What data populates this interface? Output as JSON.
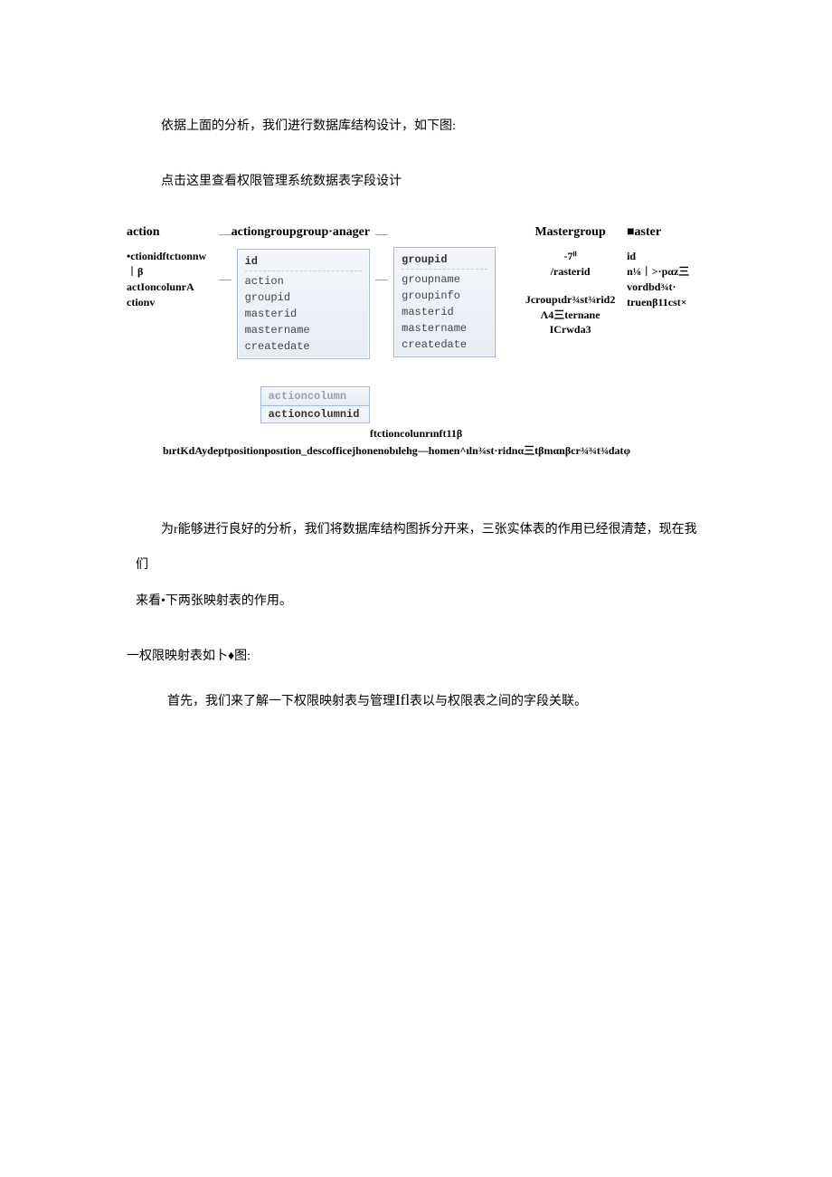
{
  "p1": "依据上面的分析，我们进行数据库结构设计，如下图:",
  "p2": "点击这里查看权限管理系统数据表字段设计",
  "diagram": {
    "col1": {
      "head": "action",
      "lines": [
        "•ctionidftctıonnw",
        "︱β",
        "actIoncolunrA",
        "ctionv"
      ]
    },
    "col2": {
      "head": "actiongroupgroup·anager",
      "box": {
        "hdr": "id",
        "rows": [
          "action",
          "groupid",
          "masterid",
          "mastername",
          "createdate"
        ]
      },
      "sub": {
        "title": "actioncolumn",
        "row": "actioncolumnid"
      }
    },
    "col3": {
      "box": {
        "hdr": "groupid",
        "rows": [
          "groupname",
          "groupinfo",
          "masterid",
          "mastername",
          "createdate"
        ]
      }
    },
    "col4": {
      "head": "Mastergroup",
      "lines": [
        "-7ⁱⁱ",
        "/rasterid",
        "",
        "Jcroupιdr¾st¾rid2",
        "Λ4三ternane",
        "ICrwda3"
      ]
    },
    "col5": {
      "head": "■aster",
      "lines": [
        "id",
        "n⅛︱>·pαz三",
        "vordbd¾t·",
        "truenβ11cst×"
      ]
    },
    "footer1": "ftctioncolunrınft11β",
    "footer2": "bırtKdAydeptpositionposıtion_descofficejhonenobılehg—homen^ıln¾st·ridnα三tβmαnβcr¾¾t¾datφ"
  },
  "p3a": "为r能够进行良好的分析，我们将数据库结构图拆分开来，三张实体表的作用已经很清楚，现在我们",
  "p3b": "来看•下两张映射表的作用。",
  "p4": "一权限映射表如卜♦图:",
  "p5_pre": "首先，我们来了解一下权限映射表与管理",
  "p5_mid": "Ifl",
  "p5_post": "表以与权限表之间的字段关联。"
}
